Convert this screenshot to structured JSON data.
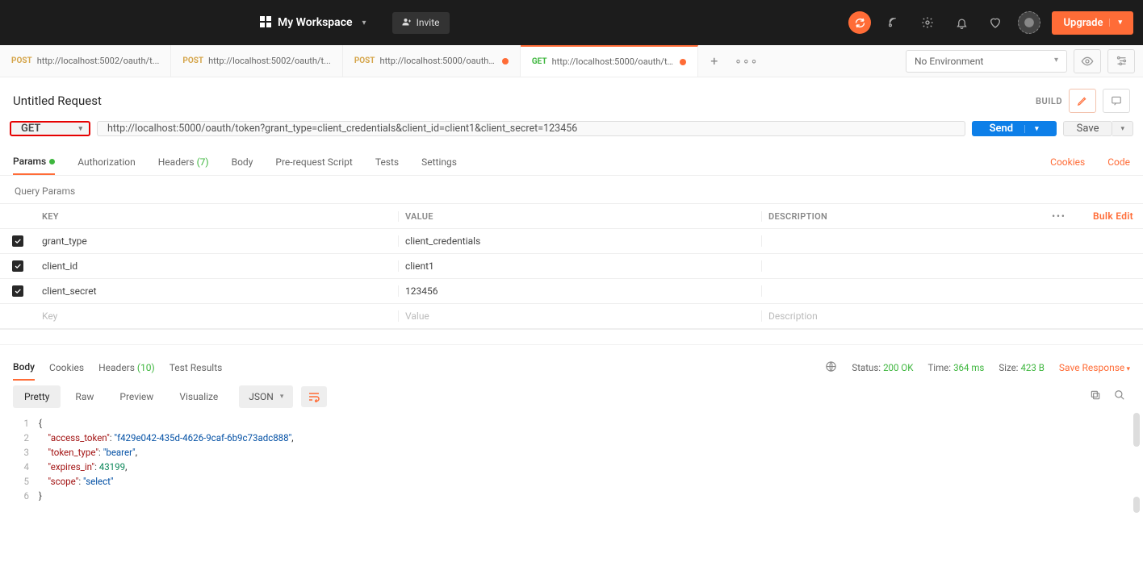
{
  "topbar": {
    "workspace_name": "My Workspace",
    "invite_label": "Invite",
    "upgrade_label": "Upgrade"
  },
  "env": {
    "selected": "No Environment"
  },
  "tabs": [
    {
      "method": "POST",
      "methodClass": "m-post",
      "label": "http://localhost:5002/oauth/t...",
      "unsaved": false
    },
    {
      "method": "POST",
      "methodClass": "m-post",
      "label": "http://localhost:5002/oauth/t...",
      "unsaved": false
    },
    {
      "method": "POST",
      "methodClass": "m-post",
      "label": "http://localhost:5000/oauth/to...",
      "unsaved": true
    },
    {
      "method": "GET",
      "methodClass": "m-get",
      "label": "http://localhost:5000/oauth/tok...",
      "unsaved": true,
      "active": true
    }
  ],
  "request": {
    "title": "Untitled Request",
    "build": "BUILD",
    "method": "GET",
    "url": "http://localhost:5000/oauth/token?grant_type=client_credentials&client_id=client1&client_secret=123456",
    "send_label": "Send",
    "save_label": "Save"
  },
  "reqtabs": {
    "params": "Params",
    "auth": "Authorization",
    "headers": "Headers",
    "headers_count": "(7)",
    "body": "Body",
    "prerequest": "Pre-request Script",
    "tests": "Tests",
    "settings": "Settings",
    "cookies": "Cookies",
    "code": "Code"
  },
  "qp": {
    "title": "Query Params",
    "col_key": "KEY",
    "col_val": "VALUE",
    "col_desc": "DESCRIPTION",
    "bulk": "Bulk Edit",
    "ph_key": "Key",
    "ph_val": "Value",
    "ph_desc": "Description",
    "rows": [
      {
        "key": "grant_type",
        "value": "client_credentials"
      },
      {
        "key": "client_id",
        "value": "client1"
      },
      {
        "key": "client_secret",
        "value": "123456"
      }
    ]
  },
  "resp": {
    "tab_body": "Body",
    "tab_cookies": "Cookies",
    "tab_headers": "Headers",
    "headers_count": "(10)",
    "tab_tests": "Test Results",
    "status_label": "Status:",
    "status_value": "200 OK",
    "time_label": "Time:",
    "time_value": "364 ms",
    "size_label": "Size:",
    "size_value": "423 B",
    "save": "Save Response"
  },
  "view": {
    "pretty": "Pretty",
    "raw": "Raw",
    "preview": "Preview",
    "visualize": "Visualize",
    "format": "JSON"
  },
  "body_json": {
    "access_token": "f429e042-435d-4626-9caf-6b9c73adc888",
    "token_type": "bearer",
    "expires_in": 43199,
    "scope": "select"
  }
}
